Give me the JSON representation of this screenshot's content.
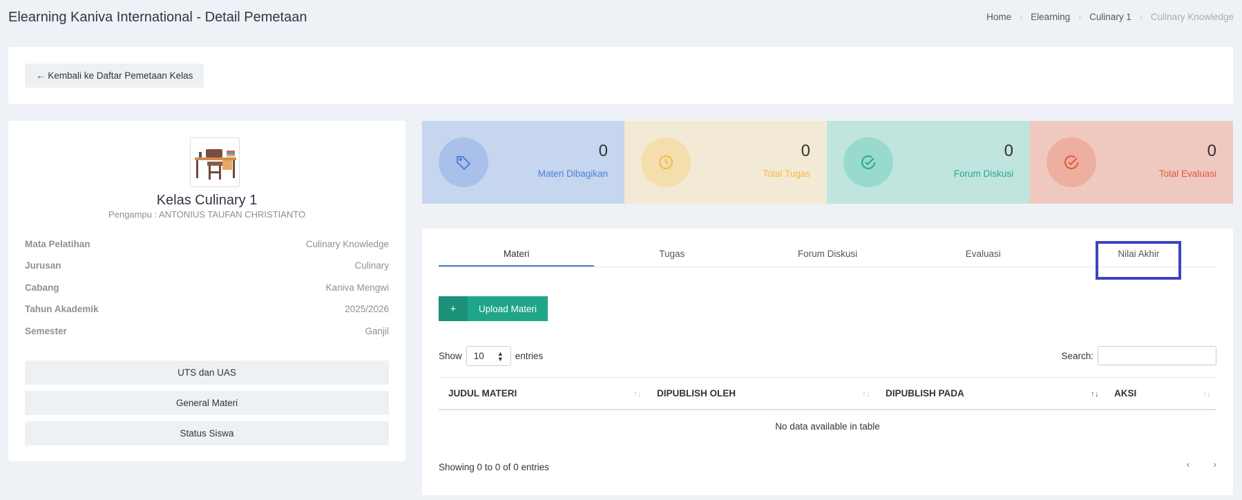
{
  "header": {
    "title": "Elearning Kaniva International - Detail Pemetaan",
    "breadcrumb": [
      "Home",
      "Elearning",
      "Culinary 1",
      "Culinary Knowledge"
    ]
  },
  "back_button": {
    "icon": "arrow-left-icon",
    "label": "← Kembali ke Daftar Pemetaan Kelas"
  },
  "profile": {
    "class_name": "Kelas Culinary 1",
    "teacher": "Pengampu : ANTONIUS TAUFAN CHRISTIANTO",
    "info": [
      {
        "label": "Mata Pelatihan",
        "value": "Culinary Knowledge"
      },
      {
        "label": "Jurusan",
        "value": "Culinary"
      },
      {
        "label": "Cabang",
        "value": "Kaniva Mengwi"
      },
      {
        "label": "Tahun Akademik",
        "value": "2025/2026"
      },
      {
        "label": "Semester",
        "value": "Ganjil"
      }
    ],
    "buttons": [
      "UTS dan UAS",
      "General Materi",
      "Status Siswa"
    ]
  },
  "stats": [
    {
      "value": "0",
      "label": "Materi Dibagikan",
      "icon": "tag-icon",
      "bg": "#c6d6ef",
      "circle": "#a9c1ea",
      "color": "#4d7ed6"
    },
    {
      "value": "0",
      "label": "Total Tugas",
      "icon": "clock-icon",
      "bg": "#f3ead5",
      "circle": "#f4dfac",
      "color": "#f3b94a"
    },
    {
      "value": "0",
      "label": "Forum Diskusi",
      "icon": "check-circle-icon",
      "bg": "#bfe5de",
      "circle": "#98dacb",
      "color": "#26a98c"
    },
    {
      "value": "0",
      "label": "Total Evaluasi",
      "icon": "check-circle-icon",
      "bg": "#efc9c0",
      "circle": "#eeaea0",
      "color": "#e0583c"
    }
  ],
  "tabs": [
    "Materi",
    "Tugas",
    "Forum Diskusi",
    "Evaluasi",
    "Nilai Akhir"
  ],
  "upload": {
    "icon": "+",
    "label": "Upload Materi"
  },
  "table": {
    "show_label": "Show",
    "entries_label": "entries",
    "page_length": "10",
    "search_label": "Search:",
    "search_value": "",
    "columns": [
      "JUDUL MATERI",
      "DIPUBLISH OLEH",
      "DIPUBLISH PADA",
      "AKSI"
    ],
    "empty_text": "No data available in table",
    "info": "Showing 0 to 0 of 0 entries",
    "prev": "‹",
    "next": "›"
  }
}
